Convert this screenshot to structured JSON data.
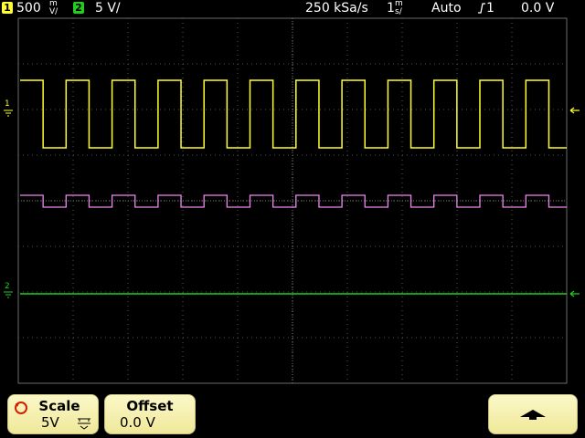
{
  "status": {
    "ch1_num": "1",
    "ch1_scale": "500",
    "ch1_unit_top": "m",
    "ch1_unit_bottom": "V/",
    "ch2_num": "2",
    "ch2_scale": "5 V/",
    "sample_rate": "250 kSa/s",
    "timebase_num": "1",
    "timebase_unit_top": "m",
    "timebase_unit_bottom": "s/",
    "trigger_mode": "Auto",
    "trigger_source": "1",
    "trigger_level": "0.0 V"
  },
  "markers": {
    "ch1_marker": "1",
    "ch2_marker": "2"
  },
  "softkeys": {
    "scale_title": "Scale",
    "scale_value": "5V",
    "offset_title": "Offset",
    "offset_value": "0.0 V"
  },
  "colors": {
    "ch1": "#ffff33",
    "ch2": "#22cc22",
    "math": "#ee88ee",
    "grid": "#5a5a5a",
    "softkey": "#f7f2b3"
  },
  "icons": {
    "scale_knob": "rotate-knob-icon",
    "fine_coarse": "fine-coarse-icon",
    "trigger_edge": "rising-edge-icon",
    "up_arrow": "up-arrow-icon"
  }
}
